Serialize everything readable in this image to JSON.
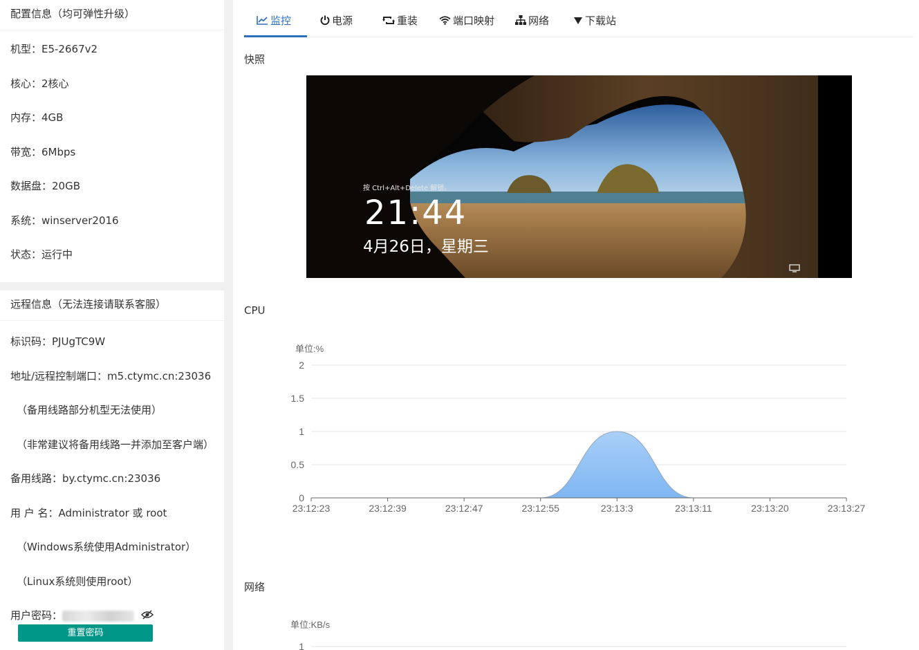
{
  "config": {
    "title": "配置信息（均可弹性升级）",
    "rows": [
      "机型：E5-2667v2",
      "核心：2核心",
      "内存：4GB",
      "带宽：6Mbps",
      "数据盘：20GB",
      "系统：winserver2016",
      "状态：运行中"
    ]
  },
  "remote": {
    "title": "远程信息（无法连接请联系客服）",
    "id_line": "标识码：PJUgTC9W",
    "address_line": "地址/远程控制端口：m5.ctymc.cn:23036",
    "note1": "（备用线路部分机型无法使用）",
    "note2": "（非常建议将备用线路一并添加至客户端）",
    "backup_line": "备用线路：by.ctymc.cn:23036",
    "username_line": "用 户 名：Administrator 或 root",
    "note3": "（Windows系统使用Administrator）",
    "note4": "（Linux系统则使用root）",
    "password_label": "用户密码：",
    "reset_button": "重置密码"
  },
  "tabs": [
    {
      "label": "监控",
      "icon": "chart-line-icon",
      "active": true
    },
    {
      "label": "电源",
      "icon": "power-icon",
      "active": false
    },
    {
      "label": "重装",
      "icon": "retweet-icon",
      "active": false
    },
    {
      "label": "端口映射",
      "icon": "wifi-icon",
      "active": false
    },
    {
      "label": "网络",
      "icon": "sitemap-icon",
      "active": false
    },
    {
      "label": "下载站",
      "icon": "caret-down-icon",
      "active": false
    }
  ],
  "snapshot": {
    "title": "快照",
    "hint": "按 Ctrl+Alt+Delete 解锁。",
    "time": "21:44",
    "date": "4月26日，星期三"
  },
  "cpu": {
    "title": "CPU"
  },
  "network": {
    "title": "网络"
  },
  "colors": {
    "accent": "#2e6fbd",
    "button": "#009688",
    "area_top": "#a9cff7",
    "area_bottom": "#7fb6f2"
  },
  "chart_data": [
    {
      "type": "area",
      "unit_label": "单位:%",
      "x": [
        "23:12:23",
        "23:12:39",
        "23:12:47",
        "23:12:55",
        "23:13:3",
        "23:13:11",
        "23:13:20",
        "23:13:27"
      ],
      "series": [
        {
          "values": [
            0,
            0,
            0,
            0,
            1,
            0,
            0,
            0
          ]
        }
      ],
      "ylim": [
        0,
        2
      ],
      "yticks": [
        0,
        0.5,
        1,
        1.5,
        2
      ],
      "grid": true
    },
    {
      "type": "line",
      "unit_label": "单位:KB/s",
      "yticks_visible": [
        1
      ],
      "grid": true
    }
  ]
}
